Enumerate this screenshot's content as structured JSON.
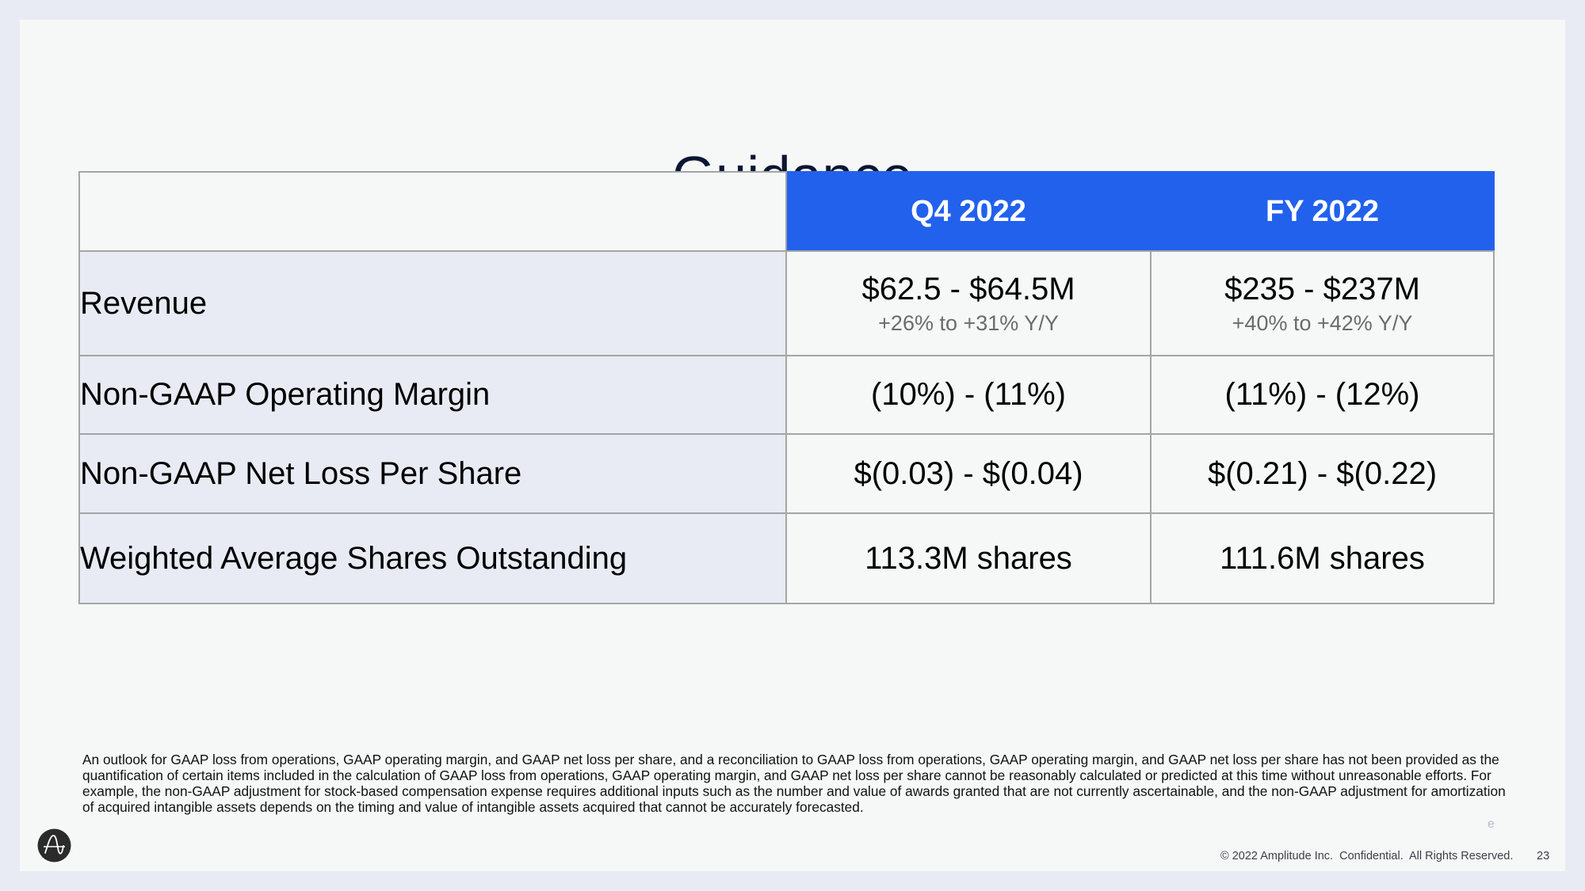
{
  "slide": {
    "title": "Guidance",
    "table": {
      "columns": [
        "",
        "Q4 2022",
        "FY 2022"
      ],
      "rows": [
        {
          "label": "Revenue",
          "q4": {
            "value": "$62.5 - $64.5M",
            "sub": "+26% to +31% Y/Y"
          },
          "fy": {
            "value": "$235 - $237M",
            "sub": "+40% to +42% Y/Y"
          }
        },
        {
          "label": "Non-GAAP Operating Margin",
          "q4": {
            "value": "(10%) - (11%)"
          },
          "fy": {
            "value": "(11%) - (12%)"
          }
        },
        {
          "label": "Non-GAAP Net Loss Per Share",
          "q4": {
            "value": "$(0.03) - $(0.04)"
          },
          "fy": {
            "value": "$(0.21) - $(0.22)"
          }
        },
        {
          "label": "Weighted Average Shares Outstanding",
          "q4": {
            "value": "113.3M shares"
          },
          "fy": {
            "value": "111.6M shares"
          }
        }
      ]
    },
    "footnote": "An outlook for GAAP loss from operations, GAAP operating margin, and GAAP net loss per share, and a reconciliation to GAAP loss from operations, GAAP operating margin,  and GAAP net loss per share has not been provided as the quantification of certain items included in the calculation of GAAP loss from operations, GAAP operating margin, and GAAP net loss per share cannot be reasonably calculated or predicted at this time without unreasonable efforts. For example, the non-GAAP adjustment for stock-based compensation expense requires additional inputs such as the number and value of awards granted that are not currently ascertainable, and the non-GAAP adjustment for amortization of acquired intangible assets depends on the timing and value of intangible assets acquired that cannot be accurately forecasted.",
    "mark": "e",
    "copyright": "© 2022 Amplitude Inc.  Confidential.  All Rights Reserved.",
    "page_number": "23",
    "logo": "amplitude-logo-icon"
  },
  "colors": {
    "header_blue": "#2261ec",
    "label_bg": "#e9ebf4",
    "cell_bg": "#f6f8f8",
    "title": "#0b1633"
  }
}
